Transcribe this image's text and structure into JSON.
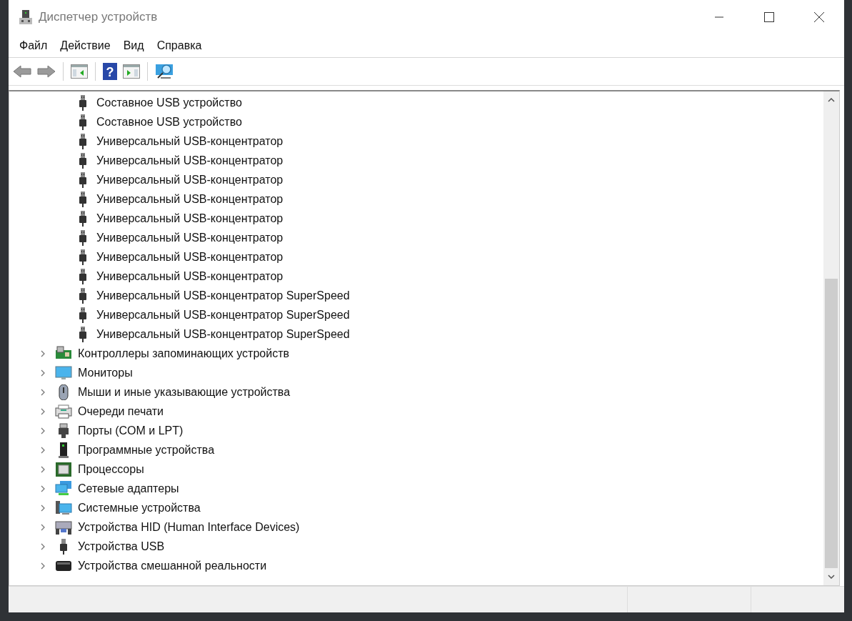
{
  "window": {
    "title": "Диспетчер устройств"
  },
  "menu": [
    "Файл",
    "Действие",
    "Вид",
    "Справка"
  ],
  "toolbar": {
    "help_glyph": "?"
  },
  "tree": [
    {
      "children": [
        {
          "label": "Составное USB устройство"
        },
        {
          "label": "Составное USB устройство"
        },
        {
          "label": "Универсальный USB-концентратор"
        },
        {
          "label": "Универсальный USB-концентратор"
        },
        {
          "label": "Универсальный USB-концентратор"
        },
        {
          "label": "Универсальный USB-концентратор"
        },
        {
          "label": "Универсальный USB-концентратор"
        },
        {
          "label": "Универсальный USB-концентратор"
        },
        {
          "label": "Универсальный USB-концентратор"
        },
        {
          "label": "Универсальный USB-концентратор"
        },
        {
          "label": "Универсальный USB-концентратор SuperSpeed"
        },
        {
          "label": "Универсальный USB-концентратор SuperSpeed"
        },
        {
          "label": "Универсальный USB-концентратор SuperSpeed"
        }
      ]
    },
    {
      "label": "Контроллеры запоминающих устройств",
      "expanded": false
    },
    {
      "label": "Мониторы",
      "expanded": false
    },
    {
      "label": "Мыши и иные указывающие устройства",
      "expanded": false
    },
    {
      "label": "Очереди печати",
      "expanded": false
    },
    {
      "label": "Порты (COM и LPT)",
      "expanded": false
    },
    {
      "label": "Программные устройства",
      "expanded": false
    },
    {
      "label": "Процессоры",
      "expanded": false
    },
    {
      "label": "Сетевые адаптеры",
      "expanded": false
    },
    {
      "label": "Системные устройства",
      "expanded": false
    },
    {
      "label": "Устройства HID (Human Interface Devices)",
      "expanded": false
    },
    {
      "label": "Устройства USB",
      "expanded": false
    },
    {
      "label": "Устройства смешанной реальности",
      "expanded": false
    }
  ]
}
